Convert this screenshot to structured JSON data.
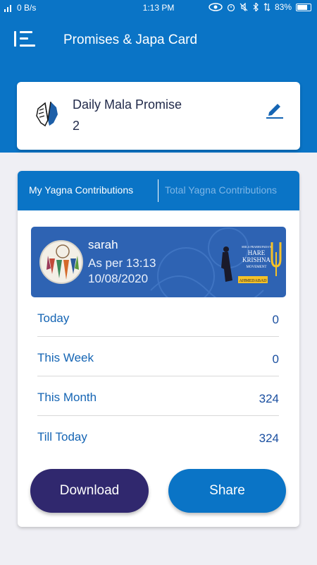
{
  "status_bar": {
    "net_speed": "0 B/s",
    "time": "1:13 PM",
    "battery": "83%"
  },
  "app_bar": {
    "title": "Promises & Japa Card",
    "menu_icon": "menu-list-icon"
  },
  "promise": {
    "label": "Daily Mala Promise",
    "value": "2",
    "icon": "praying-hands-icon",
    "edit_icon": "pencil-icon"
  },
  "tabs": {
    "active": "My Yagna Contributions",
    "inactive": "Total Yagna Contributions"
  },
  "user": {
    "name": "sarah",
    "as_per": "As per 13:13",
    "date": "10/08/2020",
    "logo": {
      "line1": "SRILA PRABHUPADA'S",
      "line2": "HARE",
      "line3": "KRISHNA",
      "line4": "MOVEMENT",
      "line5": "AHMEDABAD"
    }
  },
  "stats": [
    {
      "label": "Today",
      "value": "0"
    },
    {
      "label": "This Week",
      "value": "0"
    },
    {
      "label": "This Month",
      "value": "324"
    },
    {
      "label": "Till Today",
      "value": "324"
    }
  ],
  "buttons": {
    "download": "Download",
    "share": "Share"
  },
  "colors": {
    "primary": "#0a74c6",
    "download": "#30286e",
    "banner": "#2e63b3",
    "background": "#efeff4"
  }
}
